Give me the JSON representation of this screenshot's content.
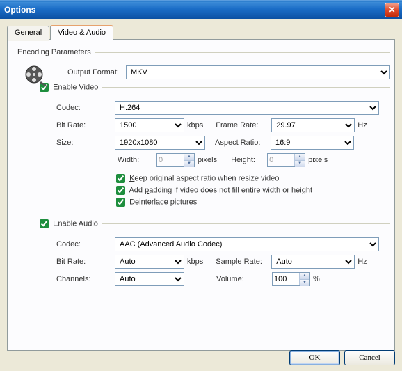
{
  "window": {
    "title": "Options"
  },
  "tabs": {
    "general": "General",
    "video_audio": "Video & Audio"
  },
  "group": {
    "encoding": "Encoding Parameters"
  },
  "outputFormat": {
    "label": "Output Format:",
    "value": "MKV"
  },
  "enableVideo": {
    "label": "Enable Video",
    "checked": true
  },
  "video": {
    "codec": {
      "label": "Codec:",
      "value": "H.264"
    },
    "bitrate": {
      "label": "Bit Rate:",
      "value": "1500",
      "unit": "kbps"
    },
    "framerate": {
      "label": "Frame Rate:",
      "value": "29.97",
      "unit": "Hz"
    },
    "size": {
      "label": "Size:",
      "value": "1920x1080"
    },
    "aspect": {
      "label": "Aspect Ratio:",
      "value": "16:9"
    },
    "width": {
      "label": "Width:",
      "value": "0",
      "unit": "pixels"
    },
    "height": {
      "label": "Height:",
      "value": "0",
      "unit": "pixels"
    },
    "keepAspect": {
      "checked": true,
      "pre": "",
      "u": "K",
      "post": "eep original aspect ratio when resize video"
    },
    "padding": {
      "checked": true,
      "pre": "Add ",
      "u": "p",
      "post": "adding if video does not fill entire width or height"
    },
    "deinterlace": {
      "checked": true,
      "pre": "D",
      "u": "e",
      "post": "interlace pictures"
    }
  },
  "enableAudio": {
    "label": "Enable Audio",
    "checked": true
  },
  "audio": {
    "codec": {
      "label": "Codec:",
      "value": "AAC (Advanced Audio Codec)"
    },
    "bitrate": {
      "label": "Bit Rate:",
      "value": "Auto",
      "unit": "kbps"
    },
    "samplerate": {
      "label": "Sample Rate:",
      "value": "Auto",
      "unit": "Hz"
    },
    "channels": {
      "label": "Channels:",
      "value": "Auto"
    },
    "volume": {
      "label": "Volume:",
      "value": "100",
      "unit": "%"
    }
  },
  "buttons": {
    "ok": "OK",
    "cancel": "Cancel"
  }
}
